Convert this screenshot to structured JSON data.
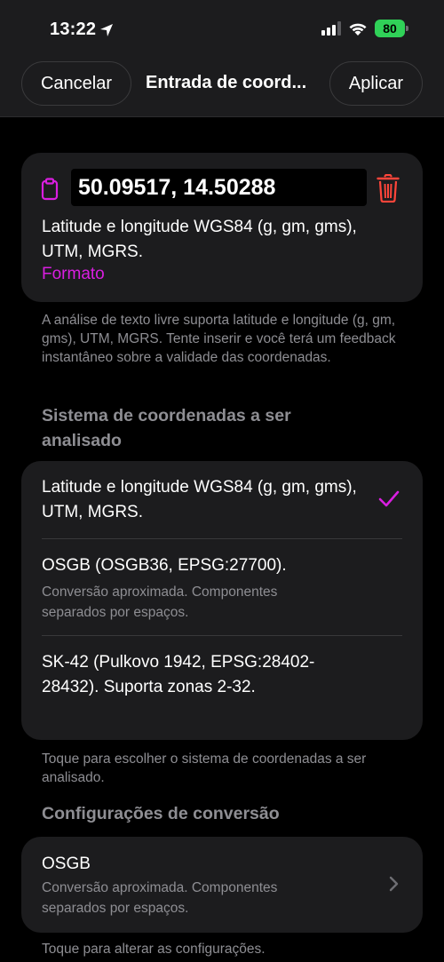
{
  "status_bar": {
    "time": "13:22",
    "battery": "80"
  },
  "nav": {
    "cancel_label": "Cancelar",
    "title": "Entrada de coord...",
    "apply_label": "Aplicar"
  },
  "input_card": {
    "coordinates_value": "50.09517, 14.50288",
    "description": "Latitude e longitude WGS84 (g, gm, gms), UTM, MGRS.",
    "format_link": "Formato"
  },
  "input_footnote": "A análise de texto livre suporta latitude e longitude (g, gm, gms), UTM, MGRS. Tente inserir e você terá um feedback instantâneo sobre a validade das coordenadas.",
  "coord_system_section": {
    "header": "Sistema de coordenadas a ser analisado",
    "options": [
      {
        "title": "Latitude e longitude WGS84 (g, gm, gms), UTM, MGRS.",
        "subtitle": "",
        "selected": true
      },
      {
        "title": "OSGB (OSGB36, EPSG:27700).",
        "subtitle": "Conversão aproximada. Componentes separados por espaços.",
        "selected": false
      },
      {
        "title": "SK-42 (Pulkovo 1942, EPSG:28402-28432). Suporta zonas 2-32.",
        "subtitle": "",
        "selected": false
      }
    ],
    "footer": "Toque para escolher o sistema de coordenadas a ser analisado."
  },
  "conversion_section": {
    "header": "Configurações de conversão",
    "item": {
      "title": "OSGB",
      "subtitle": "Conversão aproximada. Componentes separados por espaços."
    },
    "footer": "Toque para alterar as configurações."
  },
  "colors": {
    "accent": "#d91ee0",
    "danger": "#ff453a",
    "battery": "#30d158",
    "card_bg": "#1c1c1e",
    "secondary_text": "#8e8e93"
  },
  "icons": [
    "location-arrow-icon",
    "cellular-signal-icon",
    "wifi-icon",
    "battery-icon",
    "clipboard-icon",
    "trash-icon",
    "checkmark-icon",
    "chevron-right-icon"
  ]
}
